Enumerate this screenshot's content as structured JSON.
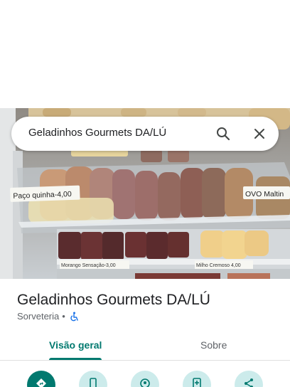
{
  "search": {
    "query": "Geladinhos Gourmets DA/LÚ",
    "search_icon": "search-icon",
    "close_icon": "close-icon"
  },
  "photo": {
    "label_left": "Paço quinha-4,00",
    "label_right": "OVO Maltin",
    "label_bottom_left": "Morango Sensação-3,00",
    "label_bottom_right": "Milho Cremoso 4,00"
  },
  "place": {
    "title": "Geladinhos Gourmets DA/LÚ",
    "category": "Sorveteria",
    "separator": "•",
    "accessibility_icon": "wheelchair-icon"
  },
  "tabs": [
    {
      "label": "Visão geral",
      "selected": true
    },
    {
      "label": "Sobre",
      "selected": false
    }
  ],
  "actions": [
    {
      "icon": "directions-icon"
    },
    {
      "icon": "phone-icon"
    },
    {
      "icon": "location-icon"
    },
    {
      "icon": "add-to-phone-icon"
    },
    {
      "icon": "share-icon"
    }
  ],
  "colors": {
    "accent": "#01796f",
    "action_bg": "#ccebeb",
    "text_secondary": "#5f6368"
  }
}
